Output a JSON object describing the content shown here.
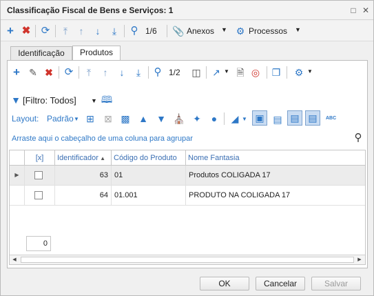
{
  "window": {
    "title": "Classificação Fiscal de Bens e Serviços: 1"
  },
  "main_toolbar": {
    "record_counter": "1/6",
    "attachments_label": "Anexos",
    "processes_label": "Processos"
  },
  "tabs": [
    {
      "label": "Identificação"
    },
    {
      "label": "Produtos"
    }
  ],
  "grid_toolbar": {
    "record_counter": "1/2"
  },
  "filter": {
    "label": "[Filtro: Todos]"
  },
  "layout_bar": {
    "layout_label": "Layout:",
    "layout_value": "Padrão"
  },
  "group_hint": "Arraste aqui o cabeçalho de uma coluna para agrupar",
  "grid": {
    "columns": [
      "[x]",
      "Identificador",
      "Código do Produto",
      "Nome Fantasia"
    ],
    "rows": [
      {
        "id": "63",
        "code": "01",
        "name": "Produtos COLIGADA 17",
        "selected": true
      },
      {
        "id": "64",
        "code": "01.001",
        "name": "PRODUTO NA COLIGADA 17",
        "selected": false
      }
    ],
    "footer_count": "0"
  },
  "buttons": {
    "ok": "OK",
    "cancel": "Cancelar",
    "save": "Salvar"
  },
  "colors": {
    "accent": "#2e78c7",
    "delete": "#d0342c",
    "selected_row": "#ececec"
  }
}
